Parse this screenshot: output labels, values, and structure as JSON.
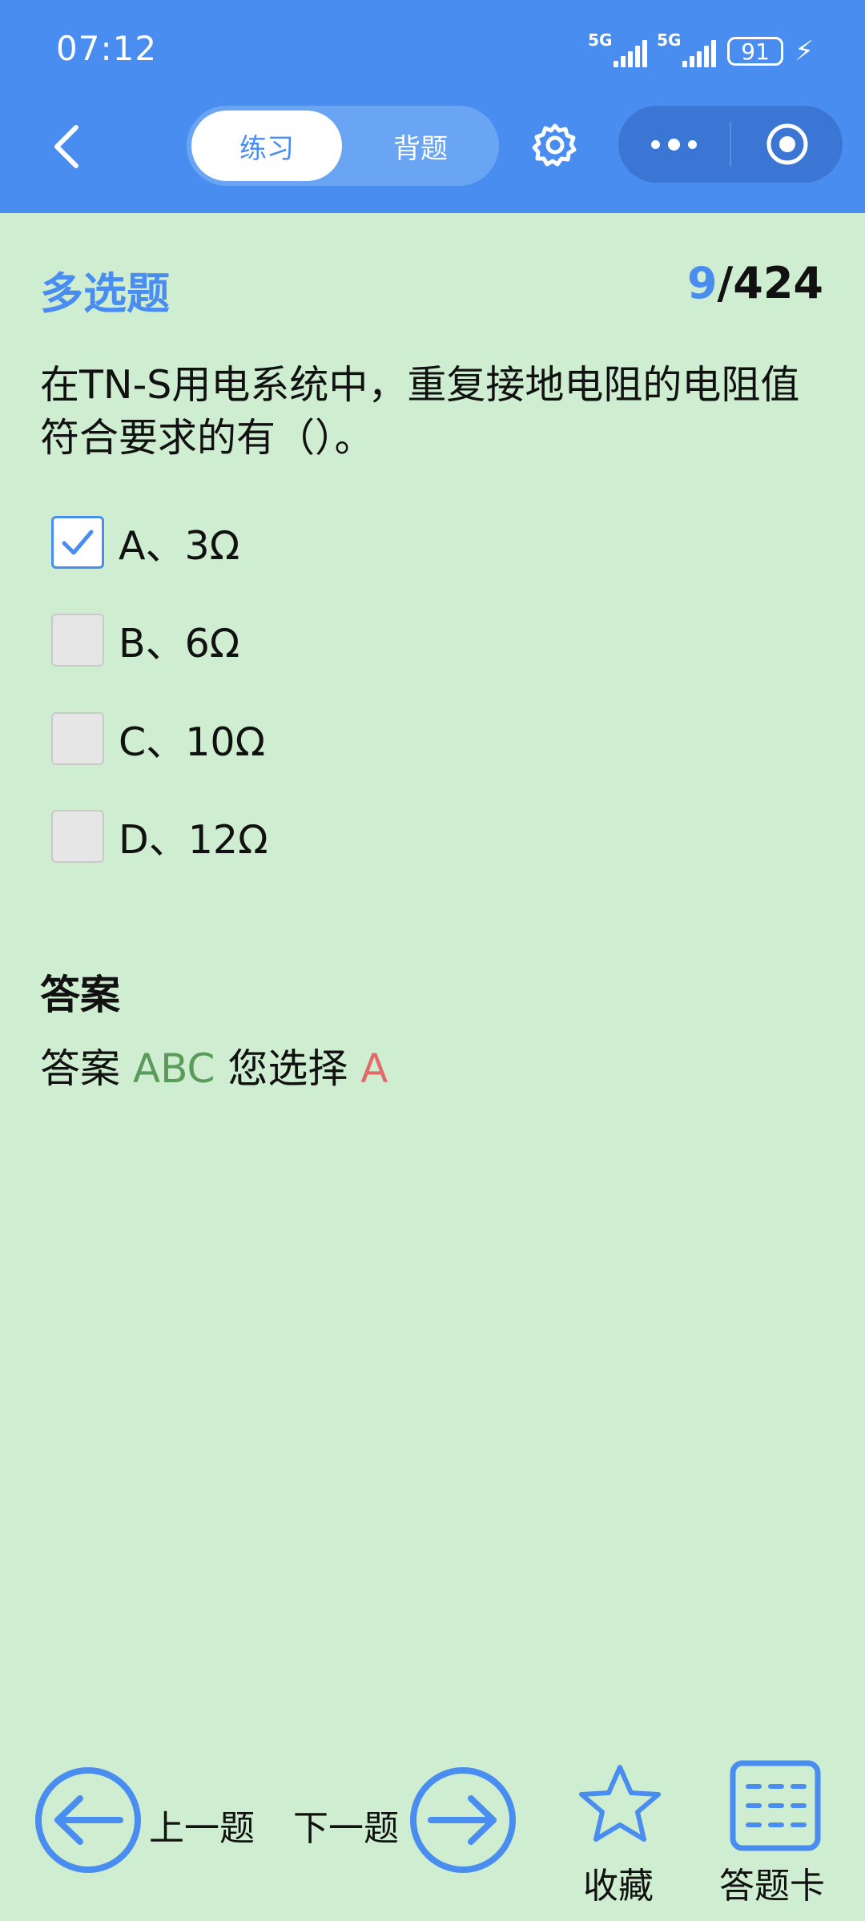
{
  "status_bar": {
    "time": "07:12",
    "signal1": "5G",
    "signal2": "5G",
    "battery": "91"
  },
  "header": {
    "tab_practice": "练习",
    "tab_memorize": "背题"
  },
  "colors": {
    "accent": "#4a8df0",
    "background": "#cfedd0",
    "correct": "#5a9a5a",
    "wrong": "#e06b6b"
  },
  "question": {
    "type": "多选题",
    "current": "9",
    "total": "/424",
    "text": "在TN-S用电系统中，重复接地电阻的电阻值符合要求的有（）。",
    "options": [
      {
        "label": "A、3Ω",
        "checked": true
      },
      {
        "label": "B、6Ω",
        "checked": false
      },
      {
        "label": "C、10Ω",
        "checked": false
      },
      {
        "label": "D、12Ω",
        "checked": false
      }
    ]
  },
  "answer": {
    "title": "答案",
    "prefix": "答案",
    "correct": "ABC",
    "chosen_label": "您选择",
    "chosen": "A"
  },
  "bottom": {
    "prev": "上一题",
    "next": "下一题",
    "favorite": "收藏",
    "answer_card": "答题卡"
  }
}
